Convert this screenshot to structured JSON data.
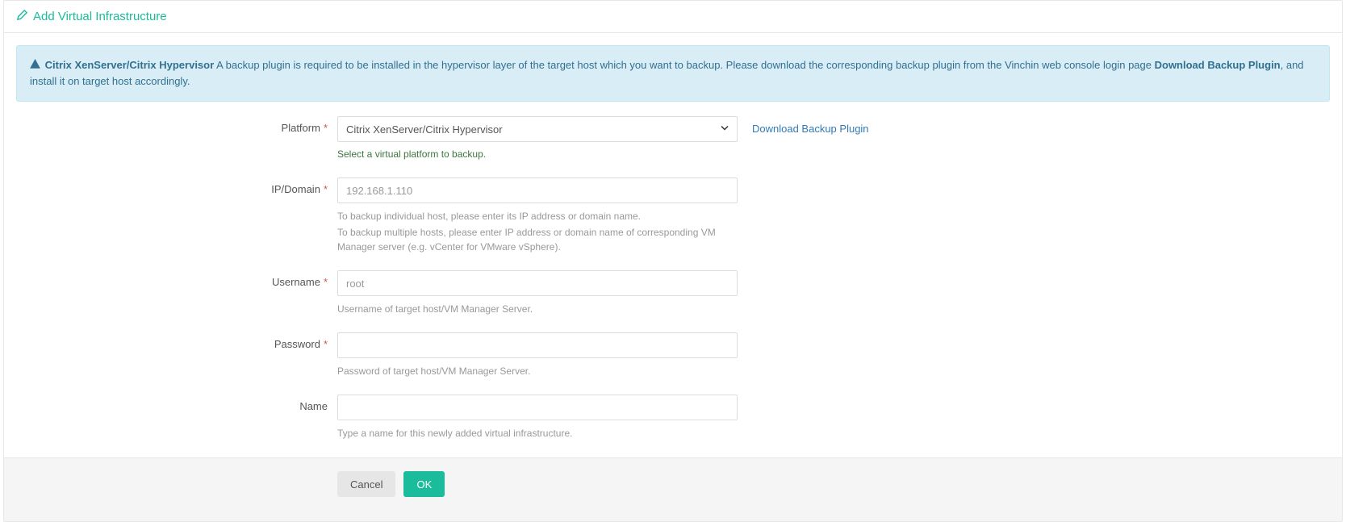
{
  "header": {
    "title": "Add Virtual Infrastructure"
  },
  "alert": {
    "bold1": "Citrix XenServer/Citrix Hypervisor",
    "text1": " A backup plugin is required to be installed in the hypervisor layer of the target host which you want to backup. Please download the corresponding backup plugin from the Vinchin web console login page ",
    "bold2": "Download Backup Plugin",
    "text2": ", and install it on target host accordingly."
  },
  "form": {
    "platform": {
      "label": "Platform",
      "value": "Citrix XenServer/Citrix Hypervisor",
      "help": "Select a virtual platform to backup.",
      "side_link": "Download Backup Plugin"
    },
    "ip": {
      "label": "IP/Domain",
      "placeholder": "192.168.1.110",
      "help1": "To backup individual host, please enter its IP address or domain name.",
      "help2": "To backup multiple hosts, please enter IP address or domain name of corresponding VM Manager server (e.g. vCenter for VMware vSphere)."
    },
    "username": {
      "label": "Username",
      "placeholder": "root",
      "help": "Username of target host/VM Manager Server."
    },
    "password": {
      "label": "Password",
      "help": "Password of target host/VM Manager Server."
    },
    "name": {
      "label": "Name",
      "help": "Type a name for this newly added virtual infrastructure."
    }
  },
  "buttons": {
    "cancel": "Cancel",
    "ok": "OK"
  }
}
